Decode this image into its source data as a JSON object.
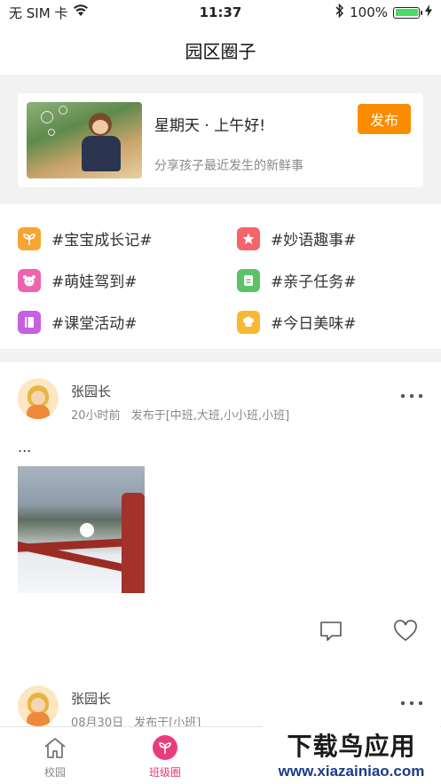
{
  "status_bar": {
    "carrier": "无 SIM 卡",
    "time": "11:37",
    "battery": "100%",
    "battery_level": 1.0
  },
  "nav": {
    "title": "园区圈子"
  },
  "post_card": {
    "greeting": "星期天 · 上午好!",
    "subtitle": "分享孩子最近发生的新鲜事",
    "publish_label": "发布"
  },
  "topics": [
    {
      "label": "#宝宝成长记#",
      "icon": "sprout-icon",
      "color": "#f7a531"
    },
    {
      "label": "#妙语趣事#",
      "icon": "star-icon",
      "color": "#f4646b"
    },
    {
      "label": "#萌娃驾到#",
      "icon": "baby-face-icon",
      "color": "#f062b0"
    },
    {
      "label": "#亲子任务#",
      "icon": "task-icon",
      "color": "#5cc268"
    },
    {
      "label": "#课堂活动#",
      "icon": "book-icon",
      "color": "#c65fe0"
    },
    {
      "label": "#今日美味#",
      "icon": "chef-hat-icon",
      "color": "#f8b832"
    }
  ],
  "feed": [
    {
      "author": "张园长",
      "time": "20小时前",
      "scope": "发布于[中班,大班,小小班,小班]",
      "text": "..."
    },
    {
      "author": "张园长",
      "time": "08月30日",
      "scope": "发布于[小班]"
    }
  ],
  "tabs": [
    {
      "label": "校园",
      "icon": "home-icon",
      "active": false
    },
    {
      "label": "班级圈",
      "icon": "sprout-icon",
      "active": true
    }
  ],
  "watermark": {
    "logo": "下载鸟应用",
    "url": "www.xiazainiao.com"
  },
  "colors": {
    "accent": "#fb8c00",
    "active_tab": "#ea3c7d"
  }
}
